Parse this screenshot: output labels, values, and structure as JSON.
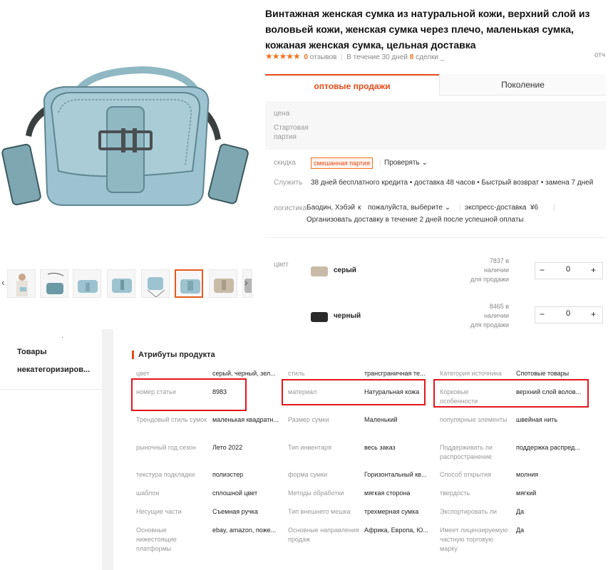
{
  "product": {
    "title": "Винтажная женская сумка из натуральной кожи, верхний слой из воловьей кожи, женская сумка через плечо, маленькая сумка, кожаная женская сумка, цельная доставка",
    "stars": "★★★★★",
    "reviews_count": "0",
    "reviews_label": "отзывов",
    "period_label": "В течение 30 дней",
    "deals_count": "8",
    "deals_label": "сделки _",
    "report_label": "отч",
    "thumbnail_count": 8,
    "active_thumbnail": 5
  },
  "tabs": {
    "wholesale": "оптовые продажи",
    "generation": "Поколение"
  },
  "price": {
    "label": "цена",
    "batch_label_1": "Стартовая",
    "batch_label_2": "партия"
  },
  "discount": {
    "label": "скидка",
    "badge": "смешанная партия",
    "check": "Проверять"
  },
  "service": {
    "label": "Служить",
    "text": "38 дней бесплатного кредита • доставка 48 часов • Быстрый возврат • замена 7 дней"
  },
  "logistics": {
    "label": "логистика",
    "origin": "Баодин, Хэбэй",
    "to": "к",
    "destination": "пожалуйста, выберите",
    "express": "экспресс-доставка",
    "price": "¥6",
    "note": "Организовать доставку в течение 2 дней после успешной оплаты"
  },
  "colors": {
    "label": "цвет",
    "items": [
      {
        "name": "серый",
        "stock_1": "7837 в",
        "stock_2": "наличии",
        "stock_3": "для продажи",
        "qty": "0",
        "swatch": "#c8bca8"
      },
      {
        "name": "черный",
        "stock_1": "8465 в",
        "stock_2": "наличии",
        "stock_3": "для продажи",
        "qty": "0",
        "swatch": "#2a2a2a"
      }
    ]
  },
  "sidebar": {
    "dot": "·",
    "line1": "Товары",
    "line2": "некатегоризиров..."
  },
  "attributes": {
    "title": "Атрибуты продукта",
    "rows": [
      [
        {
          "label": "цвет",
          "value": "серый, черный, зел..."
        },
        {
          "label": "стиль",
          "value": "трансграничная те..."
        },
        {
          "label": "Категория источника",
          "value": "Спотовые товары"
        }
      ],
      [
        {
          "label": "номер статьи",
          "value": "8983"
        },
        {
          "label": "материал",
          "value": "Натуральная кожа"
        },
        {
          "label": "Корковые особенности",
          "value": "верхний слой волов..."
        }
      ],
      [
        {
          "label": "Трендовый стиль сумок",
          "value": "маленькая квадратн..."
        },
        {
          "label": "Размер сумки",
          "value": "Маленький"
        },
        {
          "label": "популярные элементы",
          "value": "швейная нить"
        }
      ],
      [
        {
          "label": "рыночный год сезон",
          "value": "Лето 2022"
        },
        {
          "label": "Тип инвентаря",
          "value": "весь заказ"
        },
        {
          "label": "Поддерживать ли распространение",
          "value": "поддержка распред..."
        }
      ],
      [
        {
          "label": "текстура подкладки",
          "value": "полиэстер"
        },
        {
          "label": "форма сумки",
          "value": "Горизонтальный кв..."
        },
        {
          "label": "Способ открытия",
          "value": "молния"
        }
      ],
      [
        {
          "label": "шаблон",
          "value": "сплошной цвет"
        },
        {
          "label": "Методы обработки",
          "value": "мягкая сторона"
        },
        {
          "label": "твердость",
          "value": "мягкий"
        }
      ],
      [
        {
          "label": "Несущие части",
          "value": "Съемная ручка"
        },
        {
          "label": "Тип внешнего мешка",
          "value": "трехмерная сумка"
        },
        {
          "label": "Экспортировать ли",
          "value": "Да"
        }
      ],
      [
        {
          "label": "Основные нижестоящие платформы",
          "value": "ebay, amazon, поже..."
        },
        {
          "label": "Основные направления продаж",
          "value": "Африка, Европа, Ю..."
        },
        {
          "label": "Имеет лицензируемую частную торговую марку",
          "value": "Да"
        }
      ]
    ]
  },
  "colors_theme": {
    "accent": "#e44b17",
    "star": "#f0731f",
    "highlight_box": "#e3161c",
    "bag": "#9cc3cf"
  }
}
